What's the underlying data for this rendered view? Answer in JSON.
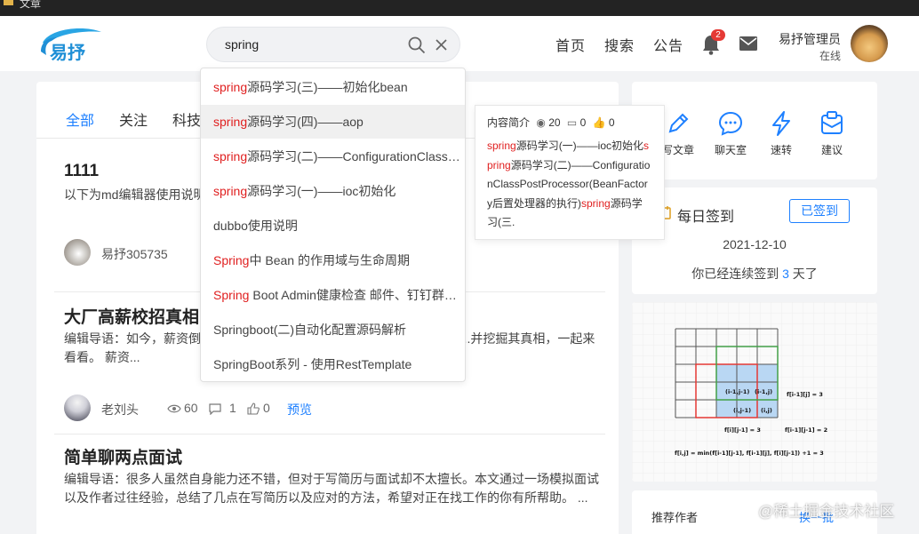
{
  "window": {
    "title": "文章"
  },
  "header": {
    "logo_text": "易抒",
    "search": {
      "value": "spring"
    },
    "nav": [
      "首页",
      "搜索",
      "公告"
    ],
    "notification_count": "2",
    "user": {
      "name": "易抒管理员",
      "status": "在线"
    }
  },
  "tabs": [
    "全部",
    "关注",
    "科技"
  ],
  "suggestions": [
    {
      "hl": "spring",
      "rest": "源码学习(三)——初始化bean"
    },
    {
      "hl": "spring",
      "rest": "源码学习(四)——aop"
    },
    {
      "hl": "spring",
      "rest": "源码学习(二)——ConfigurationClassPostProcessor"
    },
    {
      "hl": "spring",
      "rest": "源码学习(一)——ioc初始化"
    },
    {
      "hl": "",
      "rest": "dubbo使用说明"
    },
    {
      "hl": "Spring",
      "rest": "中 Bean 的作用域与生命周期"
    },
    {
      "hl": "Spring",
      "rest": " Boot Admin健康检查 邮件、钉钉群通知"
    },
    {
      "hl": "",
      "rest": "Springboot(二)自动化配置源码解析"
    },
    {
      "hl": "",
      "rest": "SpringBoot系列 - 使用RestTemplate"
    }
  ],
  "tooltip": {
    "label": "内容简介",
    "views": "20",
    "comments": "0",
    "likes": "0",
    "parts": [
      {
        "red": "spring",
        "text": "源码学习(一)——ioc初始化"
      },
      {
        "red": "spring",
        "text": "源码学习(二)——ConfigurationClassPostProcessor(BeanFactory后置处理器的执行)"
      },
      {
        "red": "spring",
        "text": "源码学习(三."
      }
    ]
  },
  "articles": [
    {
      "title": "1111",
      "desc": "以下为md编辑器使用说明...传：拖拽图片或者使用截...g”,”.jpeg”,”....",
      "author": "易抒305735"
    },
    {
      "title": "大厂高薪校招真相：",
      "desc": "编辑导语：如今，薪资倒...况，老员工很不是滋味。为什么会出现这种现...并挖掘其真相，一起来看看。 薪资...",
      "author": "老刘头",
      "views": "60",
      "comments": "1",
      "likes": "0",
      "preview": "预览"
    },
    {
      "title": "简单聊两点面试",
      "desc": "编辑导语：很多人虽然自身能力还不错，但对于写简历与面试却不太擅长。本文通过一场模拟面试以及作者过往经验，总结了几点在写简历以及应对的方法，希望对正在找工作的你有所帮助。 ..."
    }
  ],
  "quick_actions": [
    "写文章",
    "聊天室",
    "速转",
    "建议"
  ],
  "signin": {
    "title": "每日签到",
    "button": "已签到",
    "date": "2021-12-10",
    "prefix": "你已经连续签到",
    "days": "3",
    "suffix": "天了"
  },
  "diagram": {
    "labels": [
      "(i-1,j-1)",
      "(i-1,j)",
      "(i,j-1)",
      "(i,j)",
      "f[i-1][j] = 3",
      "f[i][j-1] = 3",
      "f[i-1][j-1] = 2",
      "f[i,j] = min(f[i-1][j-1], f[i-1][j], f[i][j-1]) +1 = 3"
    ]
  },
  "recommend": {
    "title": "推荐作者",
    "change": "换一批"
  },
  "watermark": "@稀土掘金技术社区"
}
